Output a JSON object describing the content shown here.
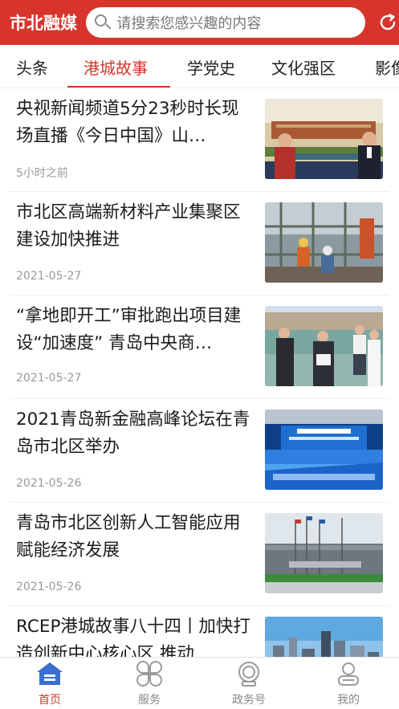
{
  "app": {
    "logo": "市北融媒",
    "search_placeholder": "请搜索您感兴趣的内容"
  },
  "tabs": [
    {
      "label": "头条"
    },
    {
      "label": "港城故事"
    },
    {
      "label": "学党史"
    },
    {
      "label": "文化强区"
    },
    {
      "label": "影像"
    }
  ],
  "active_tab": "港城故事",
  "news": [
    {
      "title": "央视新闻频道5分23秒时长现场直播《今日中国》山…",
      "time": "5小时之前",
      "thumb": "tv-news-studio"
    },
    {
      "title": "市北区高端新材料产业集聚区建设加快推进",
      "time": "2021-05-27",
      "thumb": "construction-workers"
    },
    {
      "title": "“拿地即开工”审批跑出项目建设“加速度” 青岛中央商…",
      "time": "2021-05-27",
      "thumb": "officials-site-visit"
    },
    {
      "title": "2021青岛新金融高峰论坛在青岛市北区举办",
      "time": "2021-05-26",
      "thumb": "forum-stage"
    },
    {
      "title": "青岛市北区创新人工智能应用赋能经济发展",
      "time": "2021-05-26",
      "thumb": "building-flags"
    },
    {
      "title": "RCEP港城故事八十四丨加快打造创新中心核心区 推动…",
      "time": "",
      "thumb": "city-skyline"
    }
  ],
  "bottom_nav": [
    {
      "label": "首页",
      "icon": "home-icon"
    },
    {
      "label": "服务",
      "icon": "service-grid-icon"
    },
    {
      "label": "政务号",
      "icon": "badge-icon"
    },
    {
      "label": "我的",
      "icon": "user-icon"
    }
  ],
  "colors": {
    "brand_red": "#d7352c",
    "muted_text": "#999999"
  }
}
